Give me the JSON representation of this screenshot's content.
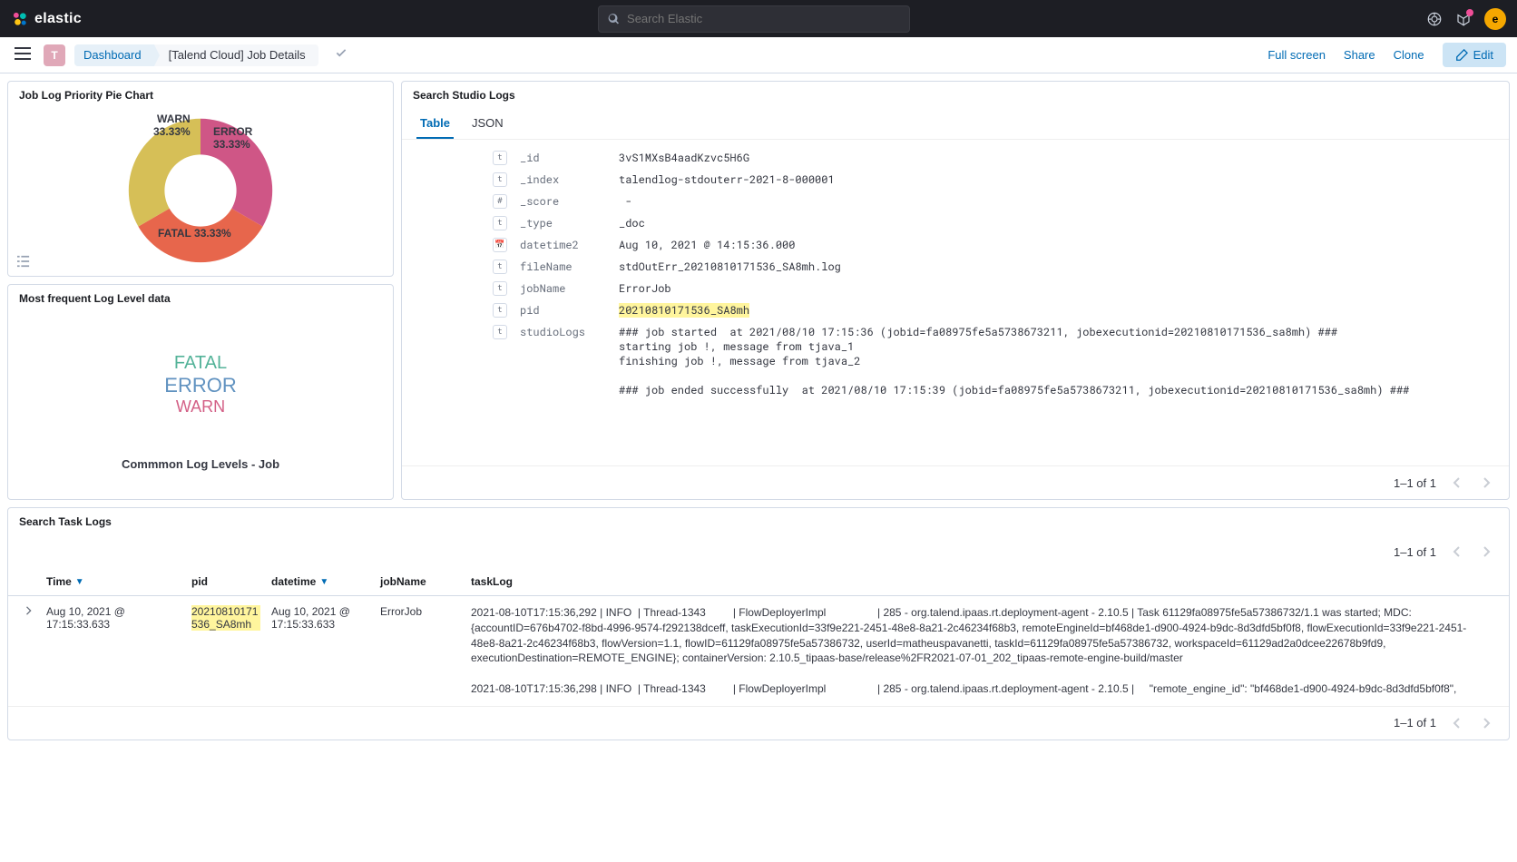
{
  "header": {
    "brand": "elastic",
    "search_placeholder": "Search Elastic",
    "avatar_letter": "e"
  },
  "breadcrumb": {
    "space_letter": "T",
    "item1": "Dashboard",
    "item2": "[Talend Cloud] Job Details"
  },
  "actions": {
    "fullscreen": "Full screen",
    "share": "Share",
    "clone": "Clone",
    "edit": "Edit"
  },
  "pie": {
    "title": "Job Log Priority Pie Chart",
    "labels": {
      "warn": "WARN",
      "warn_pct": "33.33%",
      "error": "ERROR",
      "error_pct": "33.33%",
      "fatal": "FATAL",
      "fatal_pct": "33.33%"
    }
  },
  "freq": {
    "title": "Most frequent Log Level data",
    "words": {
      "fatal": "FATAL",
      "error": "ERROR",
      "warn": "WARN"
    },
    "subtitle": "Commmon Log Levels - Job"
  },
  "studio": {
    "title": "Search Studio Logs",
    "tabs": {
      "table": "Table",
      "json": "JSON"
    },
    "fields": {
      "_id": "3vS1MXsB4aadKzvc5H6G",
      "_index": "talendlog-stdouterr-2021-8-000001",
      "_score": " - ",
      "_type": "_doc",
      "datetime2": "Aug 10, 2021 @ 14:15:36.000",
      "fileName": "stdOutErr_20210810171536_SA8mh.log",
      "jobName": "ErrorJob",
      "pid": "20210810171536_SA8mh",
      "studioLogs": "### job started  at 2021/08/10 17:15:36 (jobid=fa08975fe5a5738673211, jobexecutionid=20210810171536_sa8mh) ### \nstarting job !, message from tjava_1\nfinishing job !, message from tjava_2\n\n### job ended successfully  at 2021/08/10 17:15:39 (jobid=fa08975fe5a5738673211, jobexecutionid=20210810171536_sa8mh) ###"
    },
    "pager": "1–1 of 1"
  },
  "task": {
    "title": "Search Task Logs",
    "headers": {
      "time": "Time",
      "pid": "pid",
      "datetime": "datetime",
      "jobName": "jobName",
      "taskLog": "taskLog"
    },
    "row": {
      "time": "Aug 10, 2021 @ 17:15:33.633",
      "pid": "20210810171536_SA8mh",
      "datetime": "Aug 10, 2021 @ 17:15:33.633",
      "jobName": "ErrorJob",
      "taskLog": "2021-08-10T17:15:36,292 | INFO  | Thread-1343         | FlowDeployerImpl                 | 285 - org.talend.ipaas.rt.deployment-agent - 2.10.5 | Task 61129fa08975fe5a57386732/1.1 was started; MDC: {accountID=676b4702-f8bd-4996-9574-f292138dceff, taskExecutionId=33f9e221-2451-48e8-8a21-2c46234f68b3, remoteEngineId=bf468de1-d900-4924-b9dc-8d3dfd5bf0f8, flowExecutionId=33f9e221-2451-48e8-8a21-2c46234f68b3, flowVersion=1.1, flowID=61129fa08975fe5a57386732, userId=matheuspavanetti, taskId=61129fa08975fe5a57386732, workspaceId=61129ad2a0dcee22678b9fd9, executionDestination=REMOTE_ENGINE}; containerVersion: 2.10.5_tipaas-base/release%2FR2021-07-01_202_tipaas-remote-engine-build/master\n\n2021-08-10T17:15:36,298 | INFO  | Thread-1343         | FlowDeployerImpl                 | 285 - org.talend.ipaas.rt.deployment-agent - 2.10.5 |     \"remote_engine_id\": \"bf468de1-d900-4924-b9dc-8d3dfd5bf0f8\","
    },
    "pager": "1–1 of 1"
  },
  "chart_data": {
    "type": "pie",
    "title": "Job Log Priority Pie Chart",
    "categories": [
      "WARN",
      "ERROR",
      "FATAL"
    ],
    "values": [
      33.33,
      33.33,
      33.33
    ],
    "colors": [
      "#d6bf57",
      "#cf5686",
      "#e7664c"
    ]
  }
}
